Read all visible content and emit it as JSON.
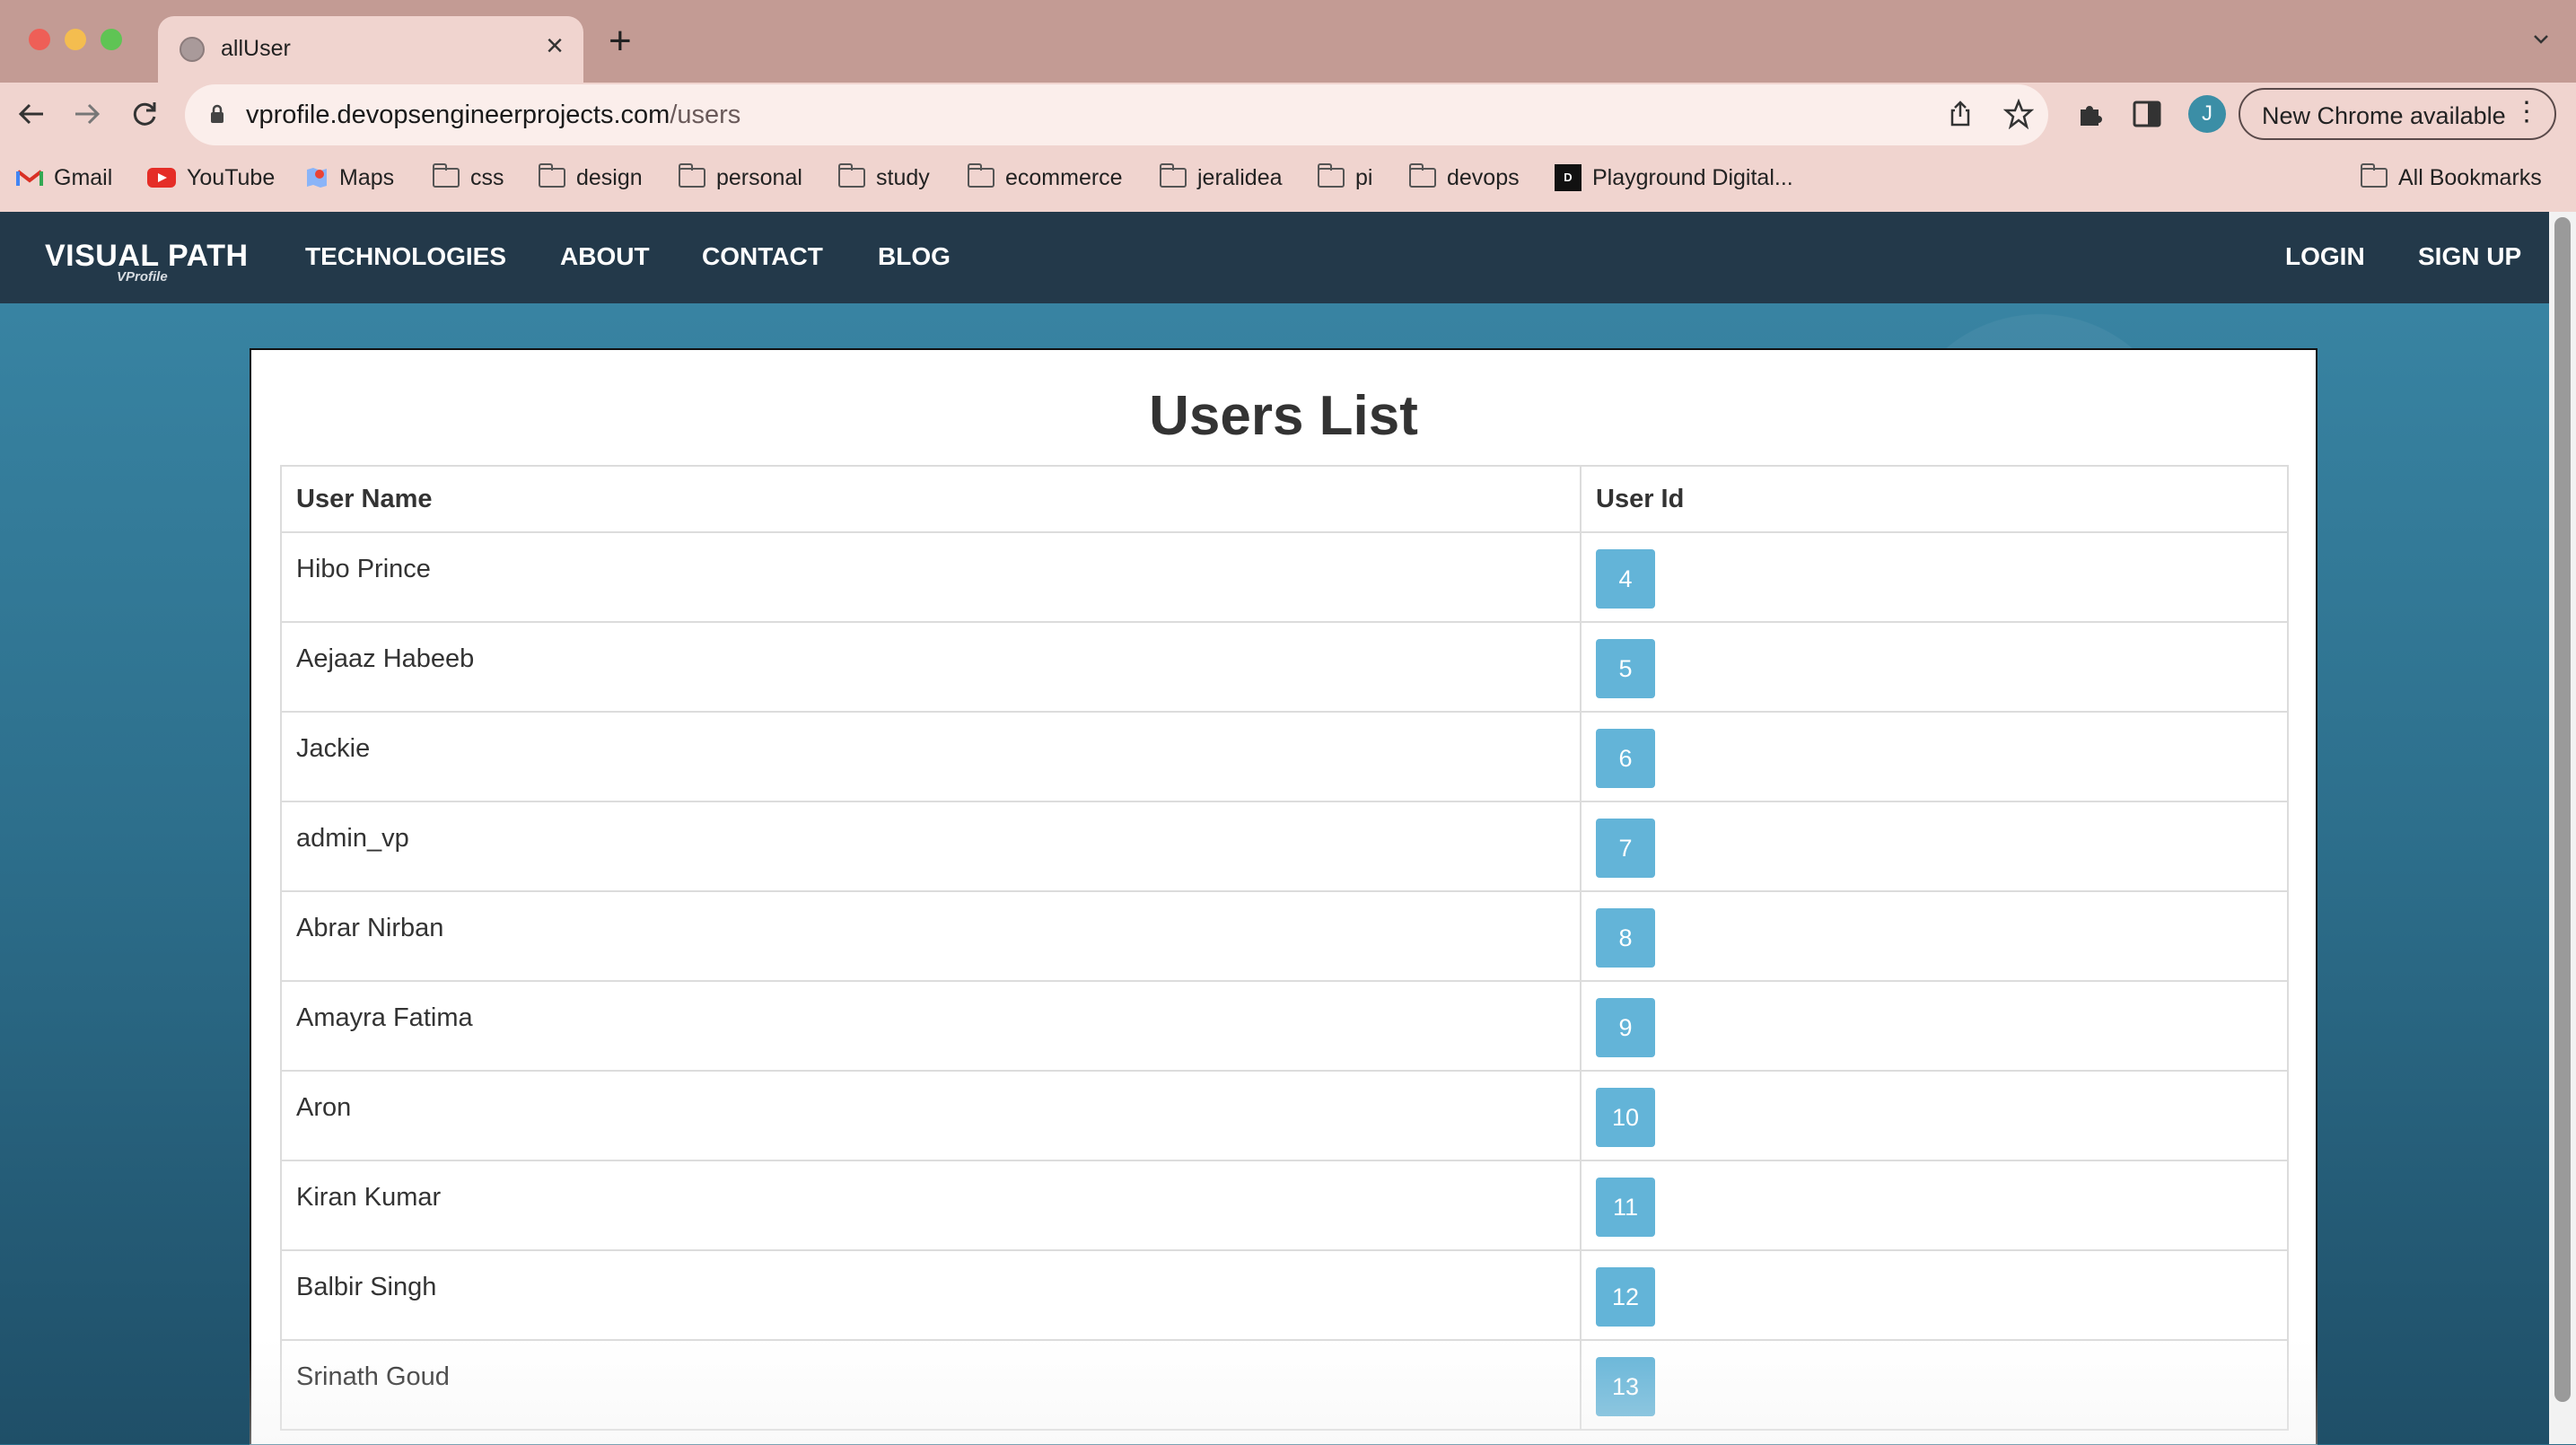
{
  "browser": {
    "tab_title": "allUser",
    "url_host": "vprofile.devopsengineerprojects.com",
    "url_path": "/users",
    "profile_initial": "J",
    "update_label": "New Chrome available",
    "bookmarks": [
      {
        "label": "Gmail",
        "icon": "gmail-icon"
      },
      {
        "label": "YouTube",
        "icon": "youtube-icon"
      },
      {
        "label": "Maps",
        "icon": "maps-icon"
      },
      {
        "label": "css",
        "icon": "folder-icon"
      },
      {
        "label": "design",
        "icon": "folder-icon"
      },
      {
        "label": "personal",
        "icon": "folder-icon"
      },
      {
        "label": "study",
        "icon": "folder-icon"
      },
      {
        "label": "ecommerce",
        "icon": "folder-icon"
      },
      {
        "label": "jeralidea",
        "icon": "folder-icon"
      },
      {
        "label": "pi",
        "icon": "folder-icon"
      },
      {
        "label": "devops",
        "icon": "folder-icon"
      },
      {
        "label": "Playground Digital...",
        "icon": "playground-icon"
      }
    ],
    "all_bookmarks": "All Bookmarks"
  },
  "site": {
    "brand": "VISUAL PATH",
    "brand_sub": "VProfile",
    "nav": [
      "TECHNOLOGIES",
      "ABOUT",
      "CONTACT",
      "BLOG"
    ],
    "login": "LOGIN",
    "signup": "SIGN UP"
  },
  "users_list": {
    "title": "Users List",
    "col_name": "User Name",
    "col_id": "User Id",
    "rows": [
      {
        "name": "Hibo Prince",
        "id": "4"
      },
      {
        "name": "Aejaaz Habeeb",
        "id": "5"
      },
      {
        "name": "Jackie",
        "id": "6"
      },
      {
        "name": "admin_vp",
        "id": "7"
      },
      {
        "name": "Abrar Nirban",
        "id": "8"
      },
      {
        "name": "Amayra Fatima",
        "id": "9"
      },
      {
        "name": "Aron",
        "id": "10"
      },
      {
        "name": "Kiran Kumar",
        "id": "11"
      },
      {
        "name": "Balbir Singh",
        "id": "12"
      },
      {
        "name": "Srinath Goud",
        "id": "13"
      }
    ]
  },
  "colors": {
    "navbar": "#23394a",
    "badge": "#63b4d8",
    "page_bg": "#2d6f8c"
  }
}
